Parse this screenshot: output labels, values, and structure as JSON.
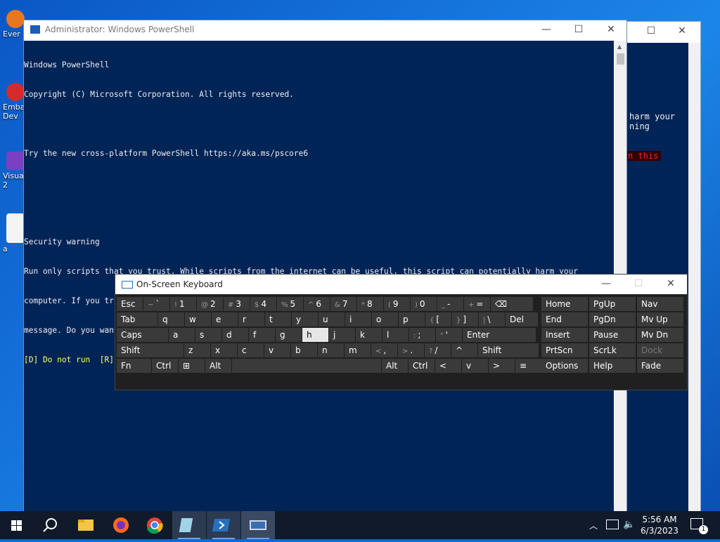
{
  "desktop": {
    "icons": [
      {
        "label": "Ever",
        "icon": "app-icon"
      },
      {
        "label": "Emba\nDev",
        "icon": "app-icon"
      },
      {
        "label": "Visua\n2",
        "icon": "app-icon"
      },
      {
        "label": "a",
        "icon": "file-icon"
      }
    ]
  },
  "back_window": {
    "lines": [
      "harm your",
      "ning",
      "n this"
    ]
  },
  "powershell": {
    "title": "Administrator: Windows PowerShell",
    "lines": [
      "Windows PowerShell",
      "Copyright (C) Microsoft Corporation. All rights reserved.",
      "",
      "Try the new cross-platform PowerShell https://aka.ms/pscore6",
      "",
      "",
      "Security warning",
      "Run only scripts that you trust. While scripts from the internet can be useful, this script can potentially harm your",
      "computer. If you trust this script, use the Unblock-File cmdlet to allow the script to run without this warning",
      "message. Do you want to run C:\\Windows\\System32\\WindowsPowerShell\\v1.0\\profile.ps1?"
    ],
    "prompt": "[D] Do not run  [R] Run once  [S] Suspend  [?] Help (default is \"D\"): "
  },
  "osk": {
    "title": "On-Screen Keyboard",
    "row1": [
      [
        "",
        "Esc"
      ],
      [
        "~",
        "`"
      ],
      [
        "!",
        "1"
      ],
      [
        "@",
        "2"
      ],
      [
        "#",
        "3"
      ],
      [
        "$",
        "4"
      ],
      [
        "%",
        "5"
      ],
      [
        "^",
        "6"
      ],
      [
        "&",
        "7"
      ],
      [
        "*",
        "8"
      ],
      [
        "(",
        "9"
      ],
      [
        ")",
        "0"
      ],
      [
        "_",
        "-"
      ],
      [
        "+",
        "="
      ],
      [
        "",
        "⌫"
      ]
    ],
    "row2": [
      [
        "",
        "Tab"
      ],
      [
        "",
        "q"
      ],
      [
        "",
        "w"
      ],
      [
        "",
        "e"
      ],
      [
        "",
        "r"
      ],
      [
        "",
        "t"
      ],
      [
        "",
        "y"
      ],
      [
        "",
        "u"
      ],
      [
        "",
        "i"
      ],
      [
        "",
        "o"
      ],
      [
        "",
        "p"
      ],
      [
        "{",
        "["
      ],
      [
        "}",
        "]"
      ],
      [
        "|",
        "\\"
      ],
      [
        "",
        "Del"
      ]
    ],
    "row3": [
      [
        "",
        "Caps"
      ],
      [
        "",
        "a"
      ],
      [
        "",
        "s"
      ],
      [
        "",
        "d"
      ],
      [
        "",
        "f"
      ],
      [
        "",
        "g"
      ],
      [
        "",
        "h"
      ],
      [
        "",
        "j"
      ],
      [
        "",
        "k"
      ],
      [
        "",
        "l"
      ],
      [
        ":",
        ";"
      ],
      [
        "\"",
        "'"
      ],
      [
        "",
        "Enter"
      ]
    ],
    "row4": [
      [
        "",
        "Shift"
      ],
      [
        "",
        "z"
      ],
      [
        "",
        "x"
      ],
      [
        "",
        "c"
      ],
      [
        "",
        "v"
      ],
      [
        "",
        "b"
      ],
      [
        "",
        "n"
      ],
      [
        "",
        "m"
      ],
      [
        "<",
        ","
      ],
      [
        ">",
        "."
      ],
      [
        "?",
        "/"
      ],
      [
        "",
        "^"
      ],
      [
        "",
        "Shift"
      ]
    ],
    "row5": [
      [
        "",
        "Fn"
      ],
      [
        "",
        "Ctrl"
      ],
      [
        "",
        "⊞"
      ],
      [
        "",
        "Alt"
      ],
      [
        "",
        ""
      ],
      [
        "",
        "Alt"
      ],
      [
        "",
        "Ctrl"
      ],
      [
        "",
        "<"
      ],
      [
        "",
        "v"
      ],
      [
        "",
        ">"
      ],
      [
        "",
        "≡"
      ]
    ],
    "nav": [
      [
        "Home",
        "PgUp",
        "Nav"
      ],
      [
        "End",
        "PgDn",
        "Mv Up"
      ],
      [
        "Insert",
        "Pause",
        "Mv Dn"
      ],
      [
        "PrtScn",
        "ScrLk",
        "Dock"
      ],
      [
        "Options",
        "Help",
        "Fade"
      ]
    ]
  },
  "taskbar": {
    "time": "5:56 AM",
    "date": "6/3/2023",
    "notification_count": "1"
  }
}
